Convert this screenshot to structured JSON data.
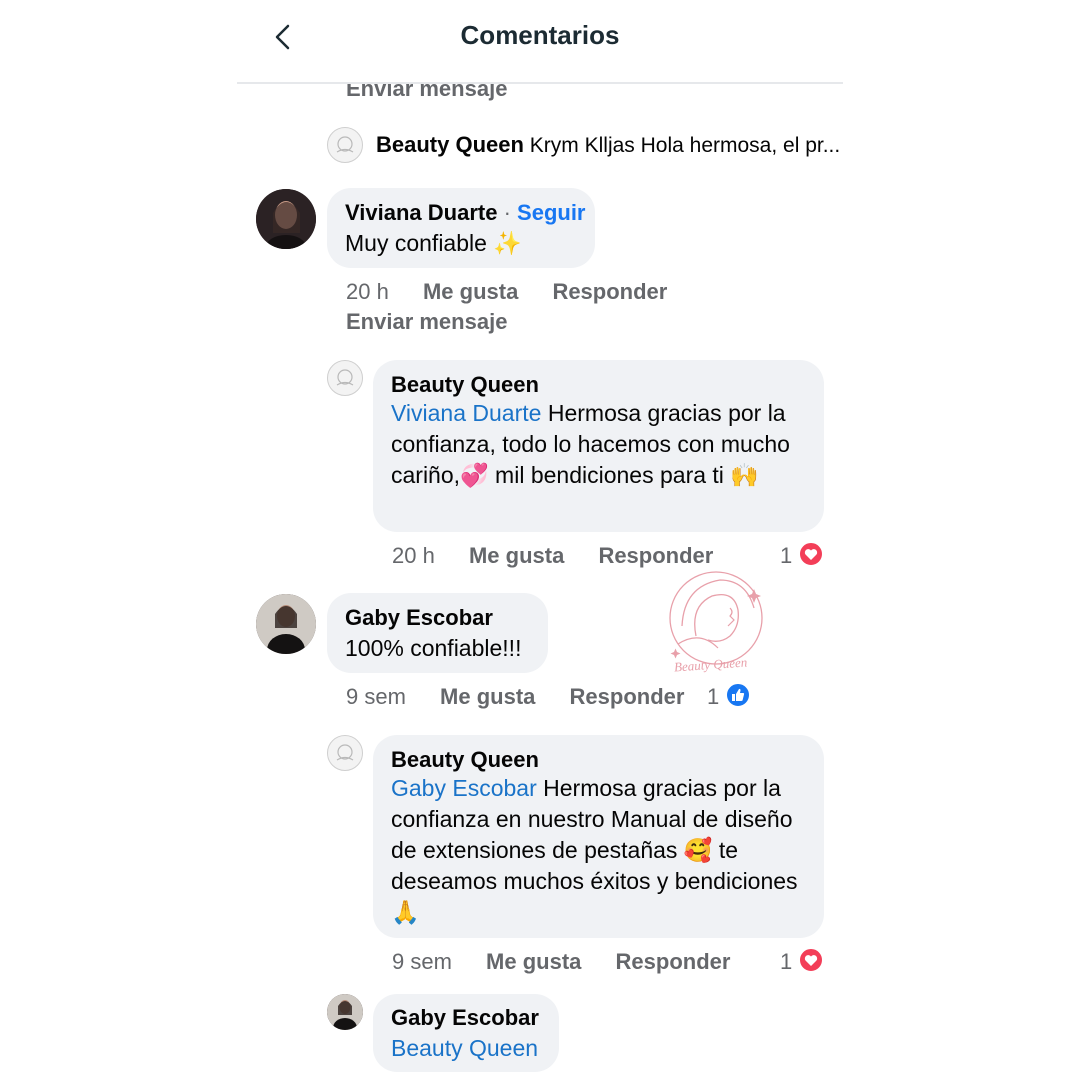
{
  "header": {
    "title": "Comentarios"
  },
  "top_partial": {
    "send_message": "Enviar mensaje"
  },
  "collapsed_reply": {
    "author": "Beauty Queen",
    "preview": "Krym Klljas Hola hermosa, el pr..."
  },
  "comment1": {
    "author": "Viviana Duarte",
    "separator": "·",
    "follow": "Seguir",
    "text": "Muy confiable ✨",
    "time": "20 h",
    "like": "Me gusta",
    "reply": "Responder",
    "send_message": "Enviar mensaje"
  },
  "reply1": {
    "author": "Beauty Queen",
    "mention": "Viviana Duarte",
    "text": " Hermosa gracias por la confianza, todo lo hacemos con mucho cariño,💞 mil bendiciones para ti 🙌",
    "time": "20 h",
    "like": "Me gusta",
    "reply": "Responder",
    "reaction_count": "1",
    "reaction_icon": "heart-icon"
  },
  "comment2": {
    "author": "Gaby Escobar",
    "text": "100% confiable!!!",
    "time": "9 sem",
    "like": "Me gusta",
    "reply": "Responder",
    "reaction_count": "1",
    "reaction_icon": "thumbs-up-icon"
  },
  "reply2": {
    "author": "Beauty Queen",
    "mention": "Gaby Escobar",
    "text": " Hermosa gracias por la confianza en nuestro Manual de diseño de extensiones de pestañas 🥰 te deseamos muchos éxitos y bendiciones 🙏",
    "time": "9 sem",
    "like": "Me gusta",
    "reply": "Responder",
    "reaction_count": "1",
    "reaction_icon": "heart-icon"
  },
  "reply3": {
    "author": "Gaby Escobar",
    "mention": "Beauty Queen"
  },
  "watermark": {
    "text": "Beauty Queen"
  },
  "colors": {
    "bubble": "#f0f2f5",
    "mention": "#1a73c8",
    "follow": "#1877f2",
    "heart": "#f33e58",
    "like": "#1877f2",
    "meta": "#65676b",
    "watermark": "#e8a0aa"
  }
}
